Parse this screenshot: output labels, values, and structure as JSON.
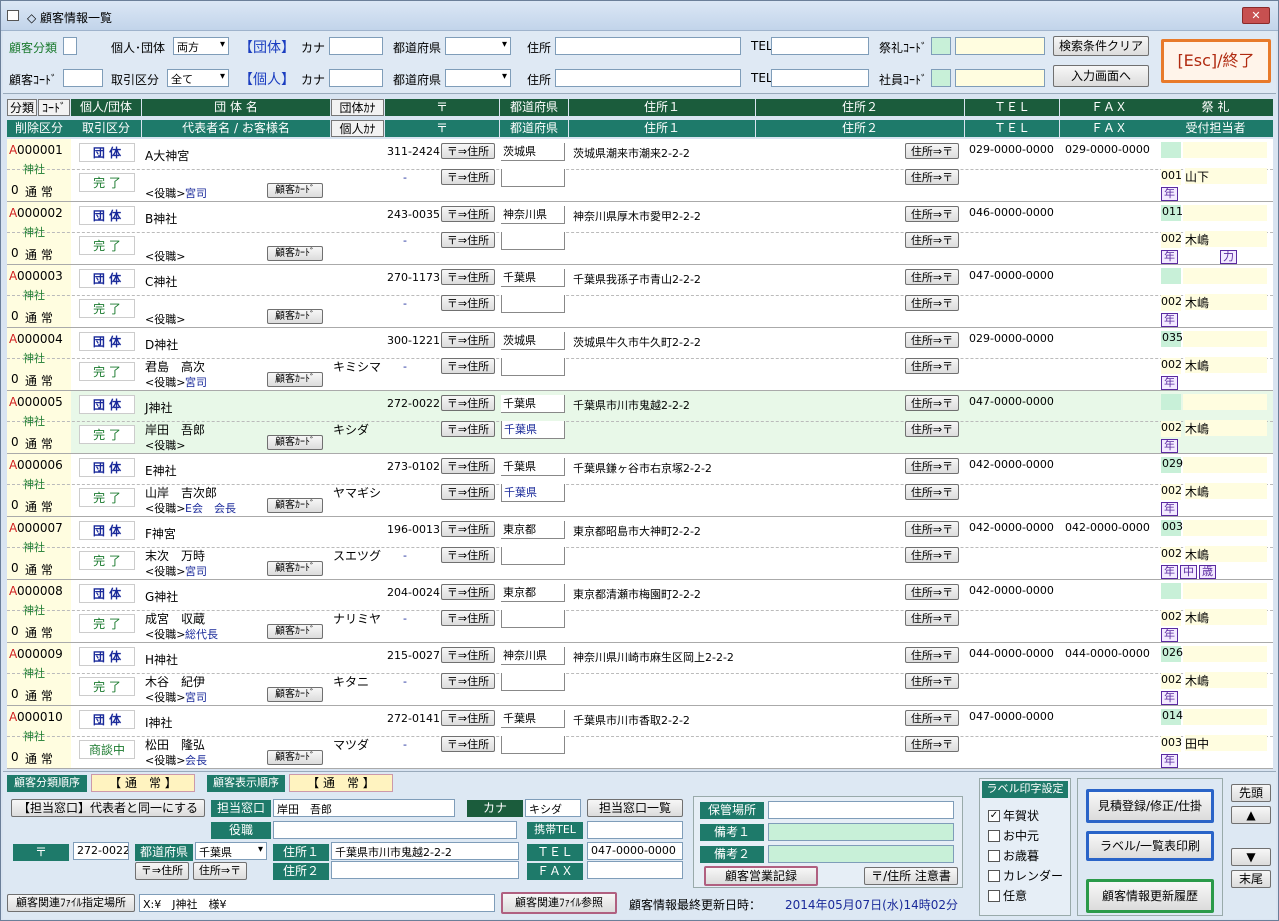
{
  "window": {
    "title": "◇ 顧客情報一覧",
    "close": "✕"
  },
  "filters": {
    "cust_class_label": "顧客分類",
    "cust_code_label": "顧客ｺｰﾄﾞ",
    "type_label": "個人･団体",
    "type_value": "両方",
    "trade_label": "取引区分",
    "trade_value": "全て",
    "group_badge": "【団体】",
    "person_badge": "【個人】",
    "kana_label": "カナ",
    "pref_label": "都道府県",
    "address_label": "住所",
    "tel_label": "TEL",
    "festival_code_label": "祭礼ｺｰﾄﾞ",
    "staff_code_label": "社員ｺｰﾄﾞ",
    "clear_button": "検索条件クリア",
    "input_screen_button": "入力画面へ",
    "exit_button": "[Esc]/終了"
  },
  "headers_top": [
    "分類",
    "ｺｰﾄﾞ",
    "個人/団体",
    "団 体 名",
    "団体ｶﾅ",
    "〒",
    "都道府県",
    "住所１",
    "住所２",
    "ＴＥＬ",
    "ＦＡＸ",
    "祭 礼"
  ],
  "headers_bottom": [
    "削除区分",
    "取引区分",
    "代表者名 / お客様名",
    "個人ｶﾅ",
    "〒",
    "都道府県",
    "住所１",
    "住所２",
    "ＴＥＬ",
    "ＦＡＸ",
    "受付担当者"
  ],
  "row_buttons": {
    "zip_to_addr": "〒⇒住所",
    "addr_to_zip": "住所⇒〒",
    "cust_card": "顧客ｶｰﾄﾞ",
    "title_label": "<役職>"
  },
  "rows": [
    {
      "del": "A",
      "code": "000001",
      "cls": "神社",
      "num": "0",
      "status": "通 常",
      "kind": "団 体",
      "trade": "完 了",
      "name": "A大神宮",
      "rep": "",
      "role": "宮司",
      "kana": "",
      "zip": "311-2424",
      "zip2": "-",
      "pref": "茨城県",
      "pref2": "",
      "addr": "茨城県潮来市潮来2-2-2",
      "tel": "029-0000-0000",
      "fax": "029-0000-0000",
      "fest": "",
      "staff_code": "001",
      "staff": "山下",
      "tags": [
        "年"
      ]
    },
    {
      "del": "A",
      "code": "000002",
      "cls": "神社",
      "num": "0",
      "status": "通 常",
      "kind": "団 体",
      "trade": "完 了",
      "name": "B神社",
      "rep": "",
      "role": "",
      "kana": "",
      "zip": "243-0035",
      "zip2": "-",
      "pref": "神奈川県",
      "pref2": "",
      "addr": "神奈川県厚木市愛甲2-2-2",
      "tel": "046-0000-0000",
      "fax": "",
      "fest": "011",
      "staff_code": "002",
      "staff": "木嶋",
      "tags": [
        "年",
        "力"
      ]
    },
    {
      "del": "A",
      "code": "000003",
      "cls": "神社",
      "num": "0",
      "status": "通 常",
      "kind": "団 体",
      "trade": "完 了",
      "name": "C神社",
      "rep": "",
      "role": "",
      "kana": "",
      "zip": "270-1173",
      "zip2": "-",
      "pref": "千葉県",
      "pref2": "",
      "addr": "千葉県我孫子市青山2-2-2",
      "tel": "047-0000-0000",
      "fax": "",
      "fest": "",
      "staff_code": "002",
      "staff": "木嶋",
      "tags": [
        "年"
      ]
    },
    {
      "del": "A",
      "code": "000004",
      "cls": "神社",
      "num": "0",
      "status": "通 常",
      "kind": "団 体",
      "trade": "完 了",
      "name": "D神社",
      "rep": "君島　高次",
      "role": "宮司",
      "kana": "キミシマ",
      "zip": "300-1221",
      "zip2": "-",
      "pref": "茨城県",
      "pref2": "",
      "addr": "茨城県牛久市牛久町2-2-2",
      "tel": "029-0000-0000",
      "fax": "",
      "fest": "035",
      "staff_code": "002",
      "staff": "木嶋",
      "tags": [
        "年"
      ]
    },
    {
      "del": "A",
      "code": "000005",
      "cls": "神社",
      "num": "0",
      "status": "通 常",
      "kind": "団 体",
      "trade": "完 了",
      "name": "J神社",
      "rep": "岸田　吾郎",
      "role": "",
      "kana": "キシダ",
      "zip": "272-0022",
      "zip2": "",
      "pref": "千葉県",
      "pref2": "千葉県",
      "addr": "千葉県市川市鬼越2-2-2",
      "tel": "047-0000-0000",
      "fax": "",
      "fest": "",
      "staff_code": "002",
      "staff": "木嶋",
      "tags": [
        "年"
      ]
    },
    {
      "del": "A",
      "code": "000006",
      "cls": "神社",
      "num": "0",
      "status": "通 常",
      "kind": "団 体",
      "trade": "完 了",
      "name": "E神社",
      "rep": "山岸　吉次郎",
      "role": "E会　会長",
      "kana": "ヤマギシ",
      "zip": "273-0102",
      "zip2": "",
      "pref": "千葉県",
      "pref2": "千葉県",
      "addr": "千葉県鎌ヶ谷市右京塚2-2-2",
      "tel": "042-0000-0000",
      "fax": "",
      "fest": "029",
      "staff_code": "002",
      "staff": "木嶋",
      "tags": [
        "年"
      ]
    },
    {
      "del": "A",
      "code": "000007",
      "cls": "神社",
      "num": "0",
      "status": "通 常",
      "kind": "団 体",
      "trade": "完 了",
      "name": "F神宮",
      "rep": "末次　万時",
      "role": "宮司",
      "kana": "スエツグ",
      "zip": "196-0013",
      "zip2": "-",
      "pref": "東京都",
      "pref2": "",
      "addr": "東京都昭島市大神町2-2-2",
      "tel": "042-0000-0000",
      "fax": "042-0000-0000",
      "fest": "003",
      "staff_code": "002",
      "staff": "木嶋",
      "tags": [
        "年",
        "中",
        "歳"
      ]
    },
    {
      "del": "A",
      "code": "000008",
      "cls": "神社",
      "num": "0",
      "status": "通 常",
      "kind": "団 体",
      "trade": "完 了",
      "name": "G神社",
      "rep": "成宮　収蔵",
      "role": "総代長",
      "kana": "ナリミヤ",
      "zip": "204-0024",
      "zip2": "-",
      "pref": "東京都",
      "pref2": "",
      "addr": "東京都清瀬市梅園町2-2-2",
      "tel": "042-0000-0000",
      "fax": "",
      "fest": "",
      "staff_code": "002",
      "staff": "木嶋",
      "tags": [
        "年"
      ]
    },
    {
      "del": "A",
      "code": "000009",
      "cls": "神社",
      "num": "0",
      "status": "通 常",
      "kind": "団 体",
      "trade": "完 了",
      "name": "H神社",
      "rep": "木谷　紀伊",
      "role": "宮司",
      "kana": "キタニ",
      "zip": "215-0027",
      "zip2": "-",
      "pref": "神奈川県",
      "pref2": "",
      "addr": "神奈川県川崎市麻生区岡上2-2-2",
      "tel": "044-0000-0000",
      "fax": "044-0000-0000",
      "fest": "026",
      "staff_code": "002",
      "staff": "木嶋",
      "tags": [
        "年"
      ]
    },
    {
      "del": "A",
      "code": "000010",
      "cls": "神社",
      "num": "0",
      "status": "通 常",
      "kind": "団 体",
      "trade": "商談中",
      "name": "I神社",
      "rep": "松田　隆弘",
      "role": "会長",
      "kana": "マツダ",
      "zip": "272-0141",
      "zip2": "-",
      "pref": "千葉県",
      "pref2": "",
      "addr": "千葉県市川市香取2-2-2",
      "tel": "047-0000-0000",
      "fax": "",
      "fest": "014",
      "staff_code": "003",
      "staff": "田中",
      "tags": [
        "年"
      ]
    }
  ],
  "bottom": {
    "class_order_label": "顧客分類順序",
    "class_order_value": "【 通　常 】",
    "display_order_label": "顧客表示順序",
    "display_order_value": "【 通　常 】",
    "same_as_rep_button": "【担当窓口】代表者と同一にする",
    "contact_label": "担当窓口",
    "contact_value": "岸田　吾郎",
    "kana_label": "カナ",
    "kana_value": "キシダ",
    "contact_list_button": "担当窓口一覧",
    "role_label": "役職",
    "mobile_label": "携帯TEL",
    "zip_label": "〒",
    "zip_value": "272-0022",
    "pref_label": "都道府県",
    "pref_value": "千葉県",
    "addr1_label": "住所１",
    "addr1_value": "千葉県市川市鬼越2-2-2",
    "addr2_label": "住所２",
    "tel_label": "ＴＥＬ",
    "tel_value": "047-0000-0000",
    "fax_label": "ＦＡＸ",
    "zip_to_addr": "〒⇒住所",
    "addr_to_zip": "住所⇒〒",
    "storage_label": "保管場所",
    "note1_label": "備考１",
    "note2_label": "備考２",
    "sales_log_button": "顧客営業記録",
    "caution_button": "〒/住所 注意書",
    "label_setting_title": "ラベル印字設定",
    "label_options": [
      {
        "label": "年賀状",
        "checked": true
      },
      {
        "label": "お中元",
        "checked": false
      },
      {
        "label": "お歳暮",
        "checked": false
      },
      {
        "label": "カレンダー",
        "checked": false
      },
      {
        "label": "任意",
        "checked": false
      }
    ],
    "estimate_button": "見積登録/修正/仕掛",
    "label_print_button": "ラベル/一覧表印刷",
    "history_button": "顧客情報更新履歴",
    "first_button": "先頭",
    "last_button": "末尾",
    "up_arrow": "▲",
    "down_arrow": "▼",
    "file_location_label": "顧客関連ﾌｧｲﾙ指定場所",
    "file_location_value": "X:¥　J神社　様¥",
    "file_ref_button": "顧客関連ﾌｧｲﾙ参照",
    "last_update_label": "顧客情報最終更新日時：",
    "last_update_value": "2014年05月07日(水)14時02分"
  }
}
